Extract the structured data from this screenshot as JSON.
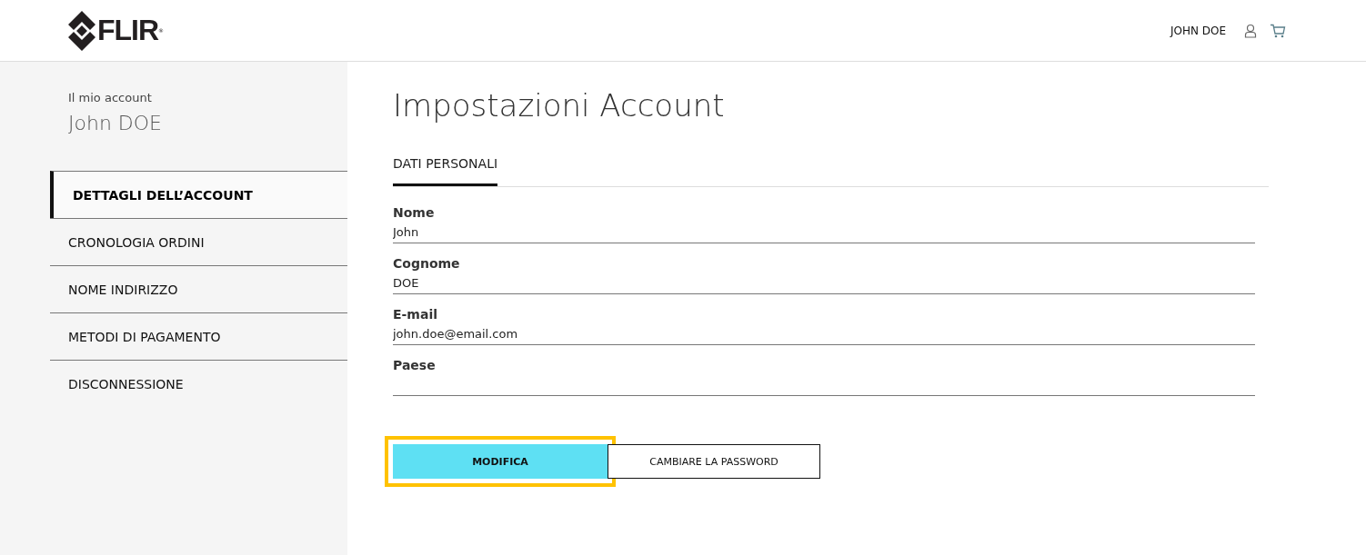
{
  "header": {
    "logo": {
      "text": "FLIR",
      "mark": "®"
    },
    "user_name": "JOHN DOE"
  },
  "sidebar": {
    "caption": "Il mio account",
    "name": "John DOE",
    "items": [
      {
        "label": "DETTAGLI DELL’ACCOUNT",
        "selected": true
      },
      {
        "label": "CRONOLOGIA ORDINI",
        "selected": false
      },
      {
        "label": "NOME INDIRIZZO",
        "selected": false
      },
      {
        "label": "METODI DI PAGAMENTO",
        "selected": false
      },
      {
        "label": "DISCONNESSIONE",
        "selected": false
      }
    ]
  },
  "title": "Impostazioni Account",
  "tabs": [
    {
      "label": "DATI PERSONALI",
      "selected": true
    }
  ],
  "fields": [
    {
      "label": "Nome",
      "value": "John"
    },
    {
      "label": "Cognome",
      "value": "DOE"
    },
    {
      "label": "E-mail",
      "value": "john.doe@email.com"
    },
    {
      "label": "Paese"
    }
  ],
  "buttons": [
    {
      "label": "MODIFICA",
      "kind": "primary",
      "focused": true
    },
    {
      "label": "CAMBIARE LA PASSWORD",
      "kind": "secondary",
      "focused": false
    }
  ]
}
